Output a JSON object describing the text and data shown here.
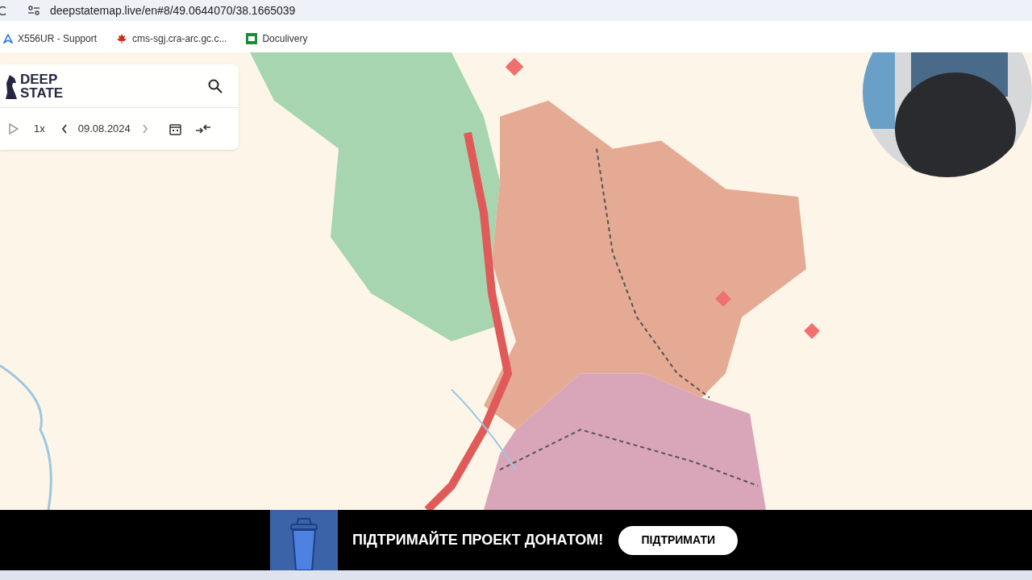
{
  "browser": {
    "url": "deepstatemap.live/en#8/49.0644070/38.1665039"
  },
  "bookmarks": [
    {
      "label": "X556UR - Support",
      "kind": "triangle"
    },
    {
      "label": "cms-sgj.cra-arc.gc.c...",
      "kind": "leaf"
    },
    {
      "label": "Doculivery",
      "kind": "np"
    }
  ],
  "panel": {
    "logo_lines": [
      "DEEP",
      "STATE"
    ],
    "speed": "1x",
    "date": "09.08.2024"
  },
  "banner": {
    "message": "ПІДТРИМАЙТЕ ПРОЕКТ ДОНАТОМ!",
    "button": "ПІДТРИМАТИ"
  }
}
